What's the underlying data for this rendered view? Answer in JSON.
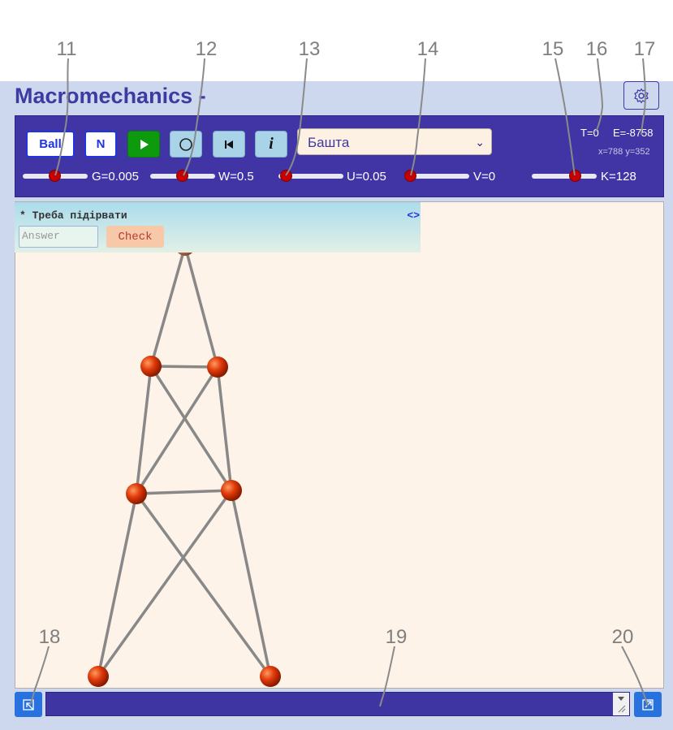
{
  "app": {
    "title": "Macromechanics -"
  },
  "toolbar": {
    "ball_button_label": "Ball",
    "n_button_label": "N",
    "play_icon": "play-icon",
    "circle_icon": "circle-icon",
    "rewind_icon": "rewind-icon",
    "info_icon": "info-icon",
    "preset_select_value": "Башта",
    "sliders": [
      {
        "name": "G",
        "label": "G=0.005",
        "level": 0.5
      },
      {
        "name": "W",
        "label": "W=0.5",
        "level": 0.5
      },
      {
        "name": "U",
        "label": "U=0.05",
        "level": 0.13
      },
      {
        "name": "V",
        "label": "V=0",
        "level": 0.08
      },
      {
        "name": "K",
        "label": "K=128",
        "level": 0.67
      }
    ],
    "stats": {
      "time": "T=0",
      "energy": "E=-8758",
      "coords": "x=788 y=352"
    }
  },
  "task": {
    "text": "* Треба підірвати",
    "toggle": "<>",
    "answer_placeholder": "Answer",
    "check_label": "Check"
  },
  "callouts": [
    "11",
    "12",
    "13",
    "14",
    "15",
    "16",
    "17",
    "18",
    "19",
    "20"
  ],
  "colors": {
    "accent": "#3d3aa2",
    "toolbar_bg": "#4134a4",
    "canvas_bg": "#fdf3e8",
    "ball": "#e03a0a",
    "rod": "#888888",
    "slider_thumb": "#c40000"
  }
}
